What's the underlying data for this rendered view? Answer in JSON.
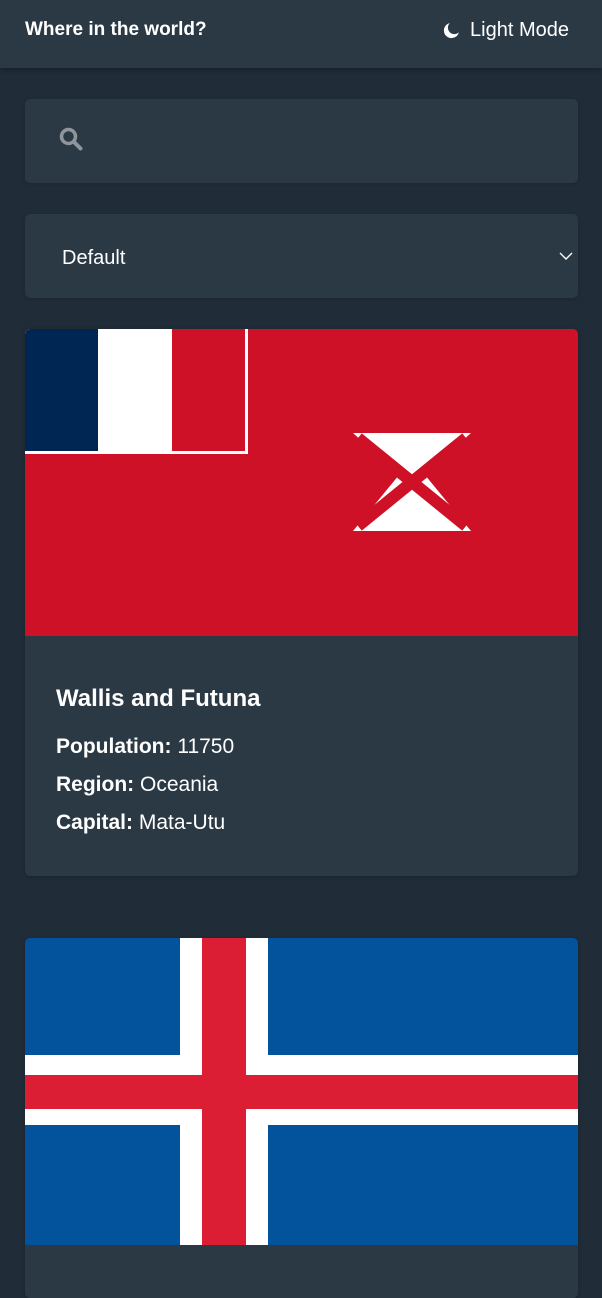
{
  "header": {
    "title": "Where in the world?",
    "mode_label": "Light Mode",
    "mode_icon": "moon-icon"
  },
  "search": {
    "icon": "search-icon",
    "value": "",
    "placeholder": ""
  },
  "filter": {
    "selected": "Default",
    "icon": "chevron-down-icon"
  },
  "countries": [
    {
      "name": "Wallis and Futuna",
      "population_label": "Population:",
      "population": "11750",
      "region_label": "Region:",
      "region": "Oceania",
      "capital_label": "Capital:",
      "capital": "Mata-Utu",
      "flag": "wallis-and-futuna-flag"
    },
    {
      "flag": "iceland-flag"
    }
  ],
  "colors": {
    "background": "#202c37",
    "element": "#2b3945",
    "text": "#ffffff",
    "wallis_red": "#ce1126",
    "france_blue": "#002654",
    "iceland_blue": "#02529c",
    "iceland_red": "#dc1e35"
  }
}
